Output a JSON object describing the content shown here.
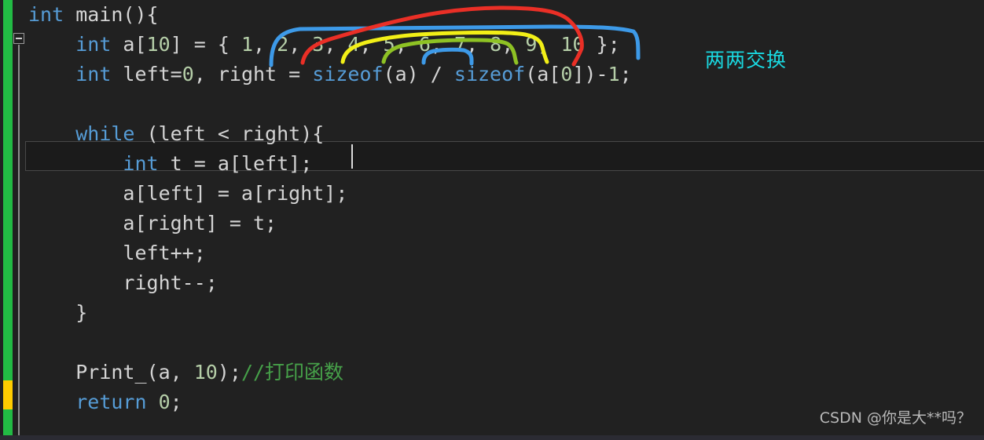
{
  "editor": {
    "background_color": "#212121",
    "default_text_color": "#d4d4d4",
    "keyword_color": "#569cd6",
    "number_color": "#b5cea8",
    "comment_color": "#46a049",
    "change_bar_color": "#22bb44",
    "change_bar_modified_color": "#ffcc00",
    "fold_icon": "collapse-minus-icon",
    "caret_visible": true,
    "current_line_index": 4
  },
  "code": {
    "lines": [
      {
        "index": 0,
        "indent": 0,
        "tokens": [
          {
            "text": "int",
            "type": "kw"
          },
          {
            "text": " main(){",
            "type": "punc"
          }
        ]
      },
      {
        "index": 1,
        "indent": 1,
        "tokens": [
          {
            "text": "int",
            "type": "kw"
          },
          {
            "text": " a[",
            "type": "punc"
          },
          {
            "text": "10",
            "type": "num"
          },
          {
            "text": "] = { ",
            "type": "punc"
          },
          {
            "text": "1",
            "type": "num"
          },
          {
            "text": ", ",
            "type": "punc"
          },
          {
            "text": "2",
            "type": "num"
          },
          {
            "text": ", ",
            "type": "punc"
          },
          {
            "text": "3",
            "type": "num"
          },
          {
            "text": ", ",
            "type": "punc"
          },
          {
            "text": "4",
            "type": "num"
          },
          {
            "text": ", ",
            "type": "punc"
          },
          {
            "text": "5",
            "type": "num"
          },
          {
            "text": ", ",
            "type": "punc"
          },
          {
            "text": "6",
            "type": "num"
          },
          {
            "text": ", ",
            "type": "punc"
          },
          {
            "text": "7",
            "type": "num"
          },
          {
            "text": ", ",
            "type": "punc"
          },
          {
            "text": "8",
            "type": "num"
          },
          {
            "text": ", ",
            "type": "punc"
          },
          {
            "text": "9",
            "type": "num"
          },
          {
            "text": ", ",
            "type": "punc"
          },
          {
            "text": "10",
            "type": "num"
          },
          {
            "text": " };",
            "type": "punc"
          }
        ]
      },
      {
        "index": 2,
        "indent": 1,
        "tokens": [
          {
            "text": "int",
            "type": "kw"
          },
          {
            "text": " left=",
            "type": "punc"
          },
          {
            "text": "0",
            "type": "num"
          },
          {
            "text": ", right = ",
            "type": "punc"
          },
          {
            "text": "sizeof",
            "type": "kw"
          },
          {
            "text": "(a) / ",
            "type": "punc"
          },
          {
            "text": "sizeof",
            "type": "kw"
          },
          {
            "text": "(a[",
            "type": "punc"
          },
          {
            "text": "0",
            "type": "num"
          },
          {
            "text": "])-",
            "type": "punc"
          },
          {
            "text": "1",
            "type": "num"
          },
          {
            "text": ";",
            "type": "punc"
          }
        ]
      },
      {
        "index": 3,
        "indent": 0,
        "tokens": []
      },
      {
        "index": 4,
        "indent": 1,
        "tokens": [
          {
            "text": "while",
            "type": "kw"
          },
          {
            "text": " (left < right){",
            "type": "punc"
          }
        ]
      },
      {
        "index": 5,
        "indent": 2,
        "tokens": [
          {
            "text": "int",
            "type": "kw"
          },
          {
            "text": " t = a[left];",
            "type": "punc"
          }
        ]
      },
      {
        "index": 6,
        "indent": 2,
        "tokens": [
          {
            "text": "a[left] = a[right];",
            "type": "punc"
          }
        ]
      },
      {
        "index": 7,
        "indent": 2,
        "tokens": [
          {
            "text": "a[right] = t;",
            "type": "punc"
          }
        ]
      },
      {
        "index": 8,
        "indent": 2,
        "tokens": [
          {
            "text": "left++;",
            "type": "punc"
          }
        ]
      },
      {
        "index": 9,
        "indent": 2,
        "tokens": [
          {
            "text": "right--;",
            "type": "punc"
          }
        ]
      },
      {
        "index": 10,
        "indent": 1,
        "tokens": [
          {
            "text": "}",
            "type": "punc"
          }
        ]
      },
      {
        "index": 11,
        "indent": 0,
        "tokens": []
      },
      {
        "index": 12,
        "indent": 1,
        "tokens": [
          {
            "text": "Print_(a, ",
            "type": "fn"
          },
          {
            "text": "10",
            "type": "num"
          },
          {
            "text": ");",
            "type": "punc"
          },
          {
            "text": "//打印函数",
            "type": "cmt"
          }
        ]
      },
      {
        "index": 13,
        "indent": 1,
        "tokens": [
          {
            "text": "return",
            "type": "kw"
          },
          {
            "text": " ",
            "type": "punc"
          },
          {
            "text": "0",
            "type": "num"
          },
          {
            "text": ";",
            "type": "punc"
          }
        ]
      }
    ]
  },
  "annotations": {
    "note_text": "两两交换",
    "note_color": "#1ad8e0",
    "arcs": [
      {
        "name": "pair-1-10",
        "color": "#3d9ae8",
        "pair": "1 ↔ 10"
      },
      {
        "name": "pair-2-9",
        "color": "#ea2f26",
        "pair": "2 ↔ 9"
      },
      {
        "name": "pair-3-8",
        "color": "#f2ef17",
        "pair": "3 ↔ 8"
      },
      {
        "name": "pair-4-7",
        "color": "#8ec224",
        "pair": "4 ↔ 7"
      },
      {
        "name": "pair-5-6",
        "color": "#3d9ae8",
        "pair": "5 ↔ 6"
      }
    ]
  },
  "watermark": {
    "text": "CSDN @你是大**吗？"
  }
}
